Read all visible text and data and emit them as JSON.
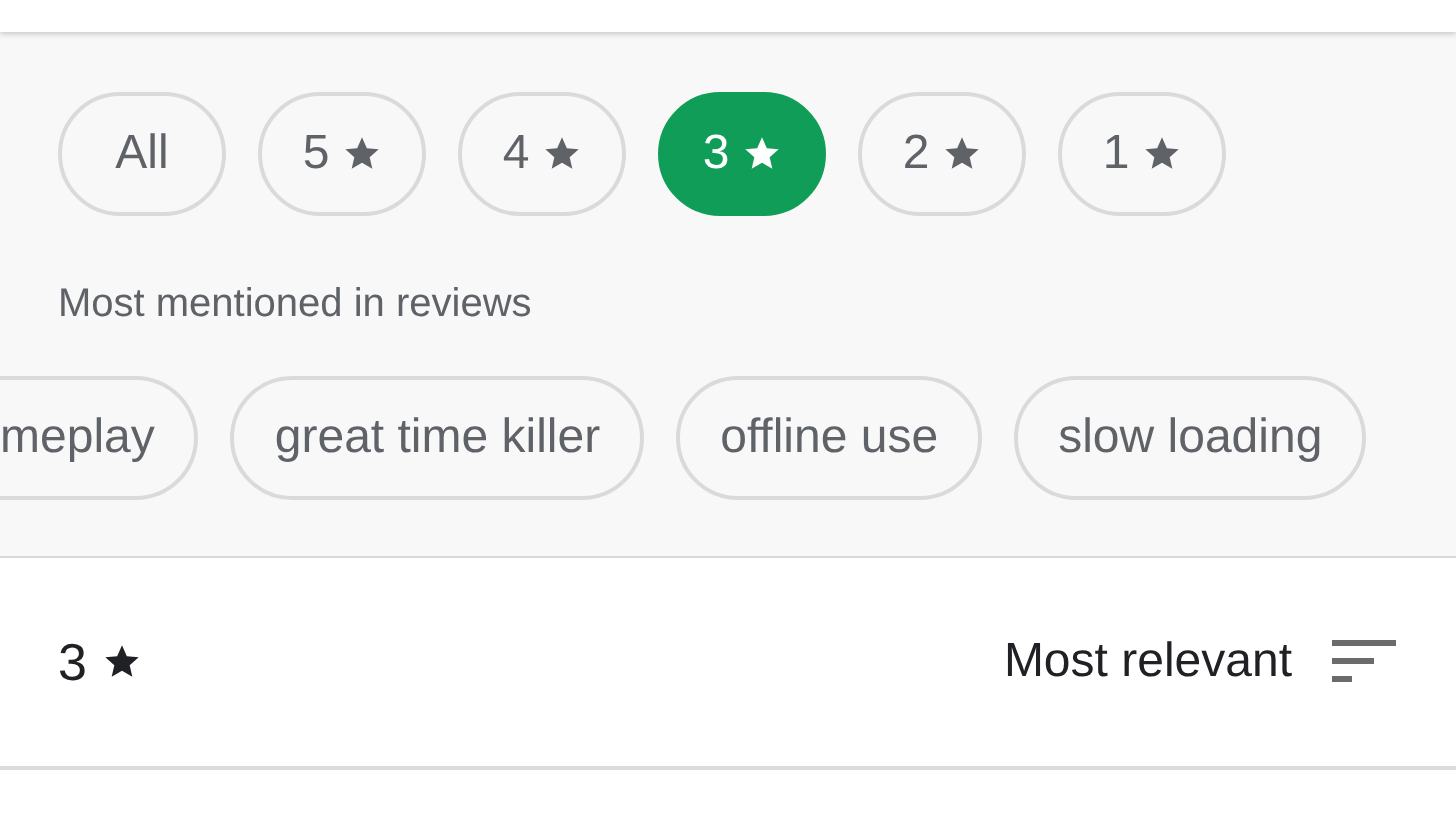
{
  "rating_filters": [
    {
      "kind": "all",
      "label": "All",
      "selected": false
    },
    {
      "kind": "stars",
      "label": "5",
      "selected": false
    },
    {
      "kind": "stars",
      "label": "4",
      "selected": false
    },
    {
      "kind": "stars",
      "label": "3",
      "selected": true
    },
    {
      "kind": "stars",
      "label": "2",
      "selected": false
    },
    {
      "kind": "stars",
      "label": "1",
      "selected": false
    }
  ],
  "mentions": {
    "title": "Most mentioned in reviews",
    "topics": [
      "meplay",
      "great time killer",
      "offline use",
      "slow loading"
    ]
  },
  "results_header": {
    "rating": "3",
    "sort_label": "Most relevant"
  }
}
